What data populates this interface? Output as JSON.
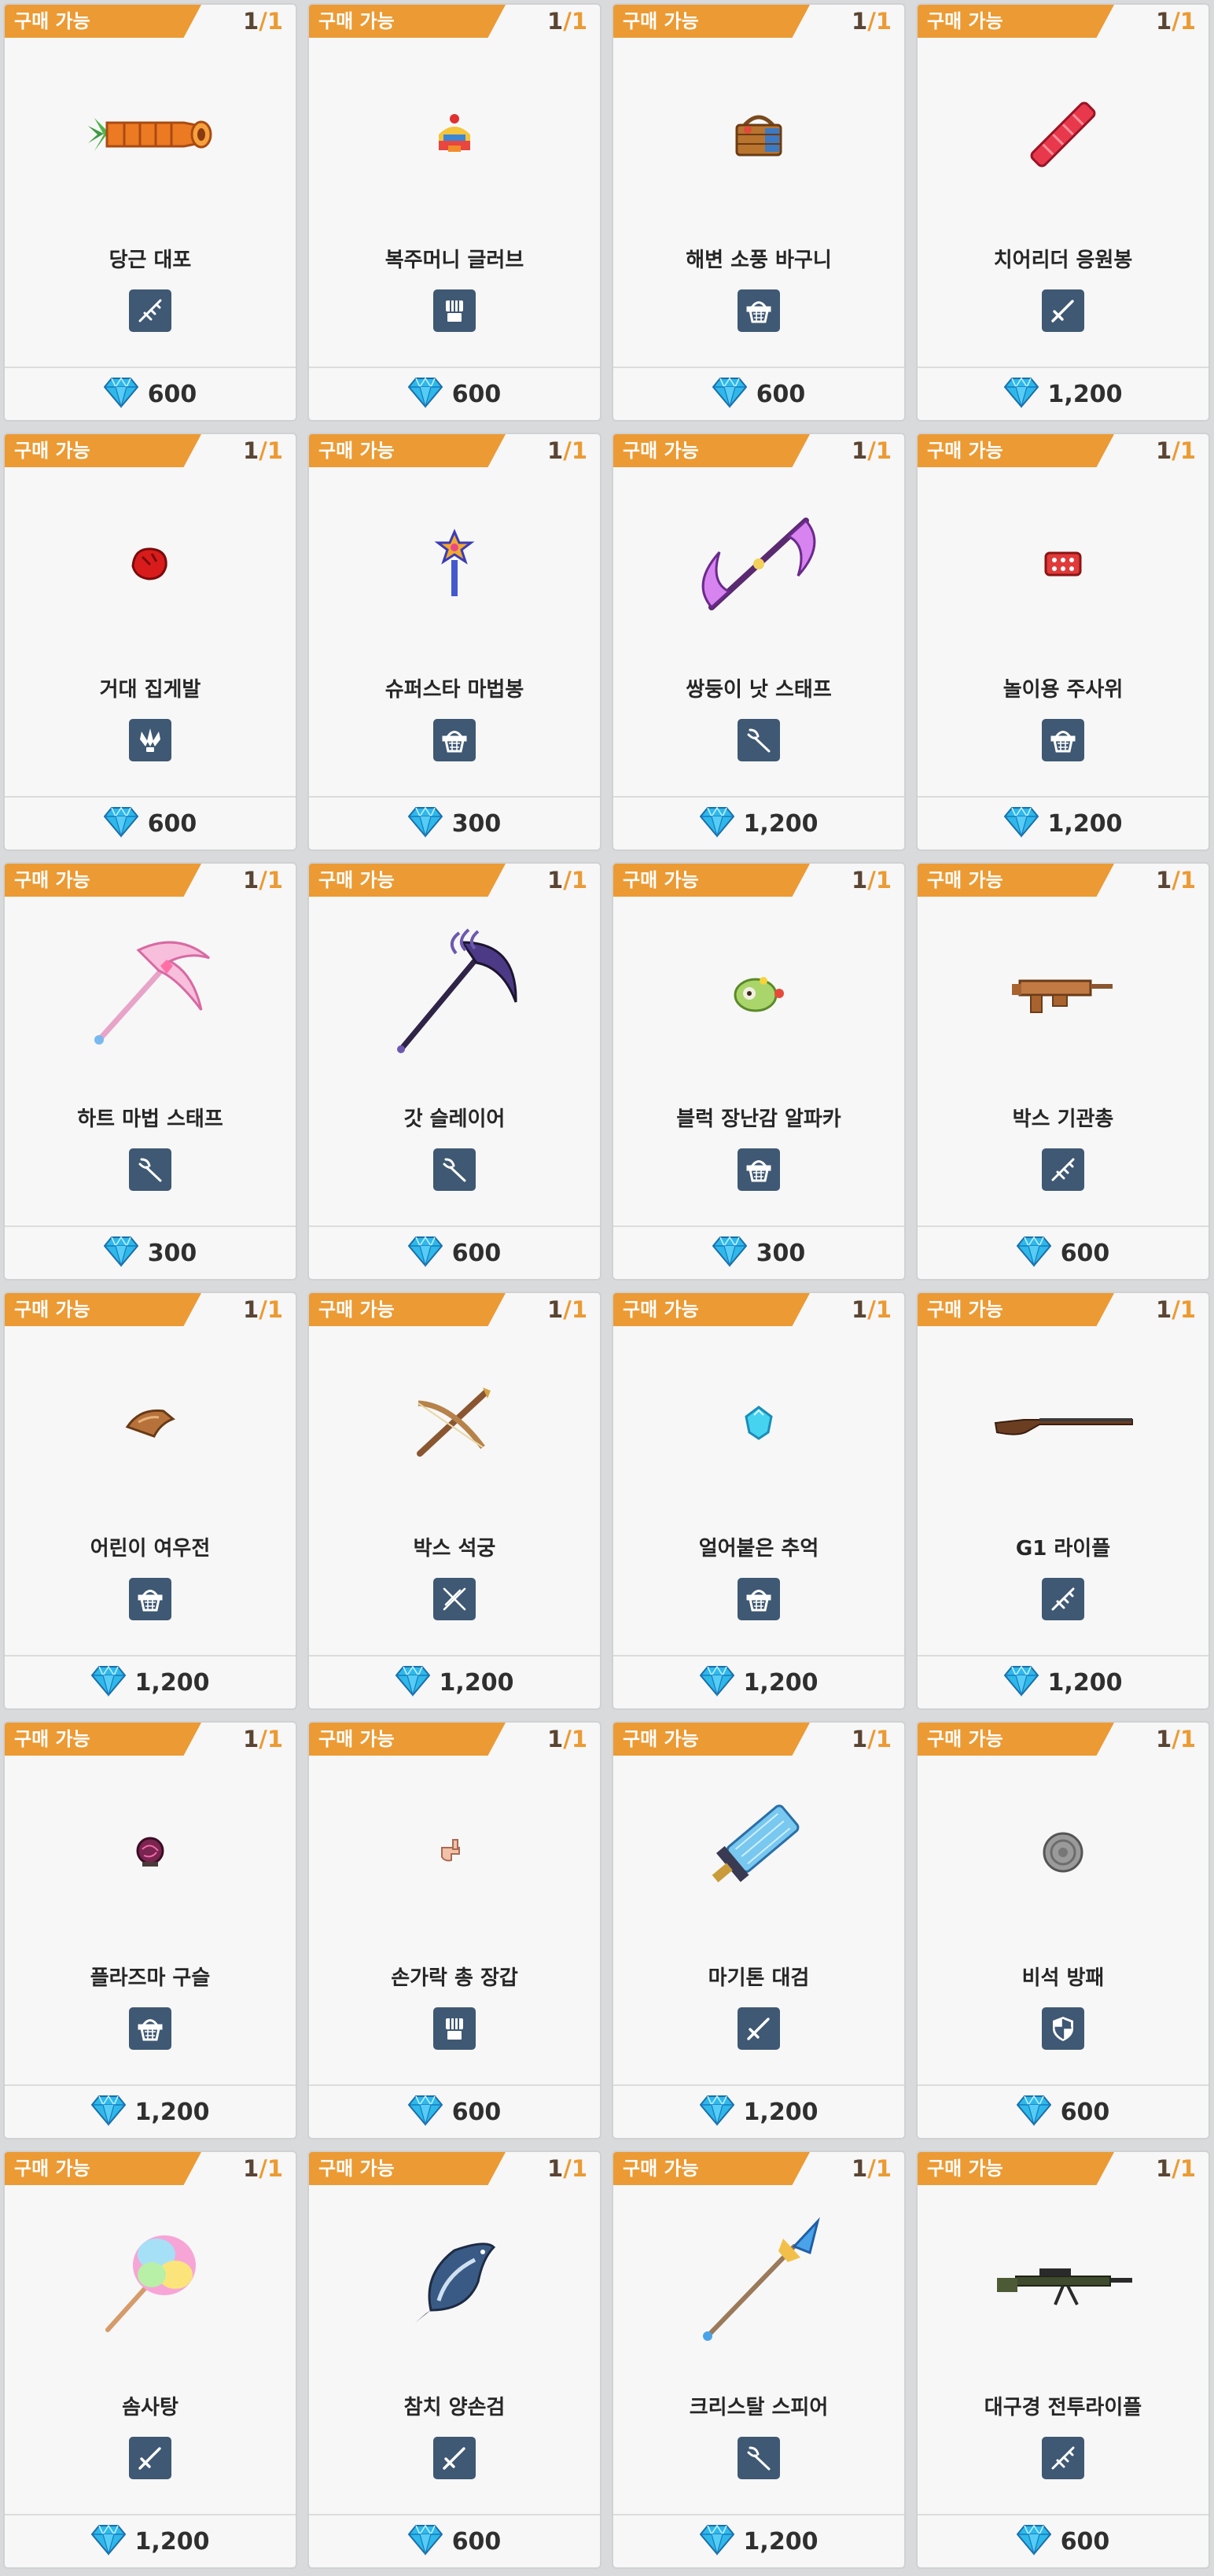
{
  "labels": {
    "available": "구매 가능"
  },
  "colors": {
    "accent": "#ec9a33",
    "badge": "#3f5873",
    "gem": "#2fb8ea"
  },
  "items": [
    {
      "name": "당근 대포",
      "count": "1",
      "max": "1",
      "type": "gun-icon",
      "art": "carrot-cannon",
      "price": "600"
    },
    {
      "name": "복주머니 글러브",
      "count": "1",
      "max": "1",
      "type": "fist-icon",
      "art": "lucky-pouch-glove",
      "price": "600"
    },
    {
      "name": "해변 소풍 바구니",
      "count": "1",
      "max": "1",
      "type": "basket-icon",
      "art": "picnic-basket",
      "price": "600"
    },
    {
      "name": "치어리더 응원봉",
      "count": "1",
      "max": "1",
      "type": "sword-icon",
      "art": "cheer-stick",
      "price": "1,200"
    },
    {
      "name": "거대 집게발",
      "count": "1",
      "max": "1",
      "type": "claw-icon",
      "art": "giant-claw",
      "price": "600"
    },
    {
      "name": "슈퍼스타 마법봉",
      "count": "1",
      "max": "1",
      "type": "basket-icon",
      "art": "superstar-wand",
      "price": "300"
    },
    {
      "name": "쌍둥이 낫 스태프",
      "count": "1",
      "max": "1",
      "type": "staff-icon",
      "art": "twin-scythe-staff",
      "price": "1,200"
    },
    {
      "name": "놀이용 주사위",
      "count": "1",
      "max": "1",
      "type": "basket-icon",
      "art": "play-dice",
      "price": "1,200"
    },
    {
      "name": "하트 마법 스태프",
      "count": "1",
      "max": "1",
      "type": "staff-icon",
      "art": "heart-magic-staff",
      "price": "300"
    },
    {
      "name": "갓 슬레이어",
      "count": "1",
      "max": "1",
      "type": "staff-icon",
      "art": "god-slayer-scythe",
      "price": "600"
    },
    {
      "name": "블럭 장난감 알파카",
      "count": "1",
      "max": "1",
      "type": "basket-icon",
      "art": "block-alpaca",
      "price": "300"
    },
    {
      "name": "박스 기관총",
      "count": "1",
      "max": "1",
      "type": "gun-icon",
      "art": "box-machinegun",
      "price": "600"
    },
    {
      "name": "어린이 여우전",
      "count": "1",
      "max": "1",
      "type": "basket-icon",
      "art": "child-fox-horn",
      "price": "1,200"
    },
    {
      "name": "박스 석궁",
      "count": "1",
      "max": "1",
      "type": "bow-icon",
      "art": "box-crossbow",
      "price": "1,200"
    },
    {
      "name": "얼어붙은 추억",
      "count": "1",
      "max": "1",
      "type": "basket-icon",
      "art": "frozen-memory",
      "price": "1,200"
    },
    {
      "name": "G1 라이플",
      "count": "1",
      "max": "1",
      "type": "gun-icon",
      "art": "g1-rifle",
      "price": "1,200"
    },
    {
      "name": "플라즈마 구슬",
      "count": "1",
      "max": "1",
      "type": "basket-icon",
      "art": "plasma-orb",
      "price": "1,200"
    },
    {
      "name": "손가락 총 장갑",
      "count": "1",
      "max": "1",
      "type": "fist-icon",
      "art": "finger-gun-glove",
      "price": "600"
    },
    {
      "name": "마기톤 대검",
      "count": "1",
      "max": "1",
      "type": "sword-icon",
      "art": "magiton-greatsword",
      "price": "1,200"
    },
    {
      "name": "비석 방패",
      "count": "1",
      "max": "1",
      "type": "shield-icon",
      "art": "tombstone-shield",
      "price": "600"
    },
    {
      "name": "솜사탕",
      "count": "1",
      "max": "1",
      "type": "sword-icon",
      "art": "cotton-candy",
      "price": "1,200"
    },
    {
      "name": "참치 양손검",
      "count": "1",
      "max": "1",
      "type": "sword-icon",
      "art": "tuna-sword",
      "price": "600"
    },
    {
      "name": "크리스탈 스피어",
      "count": "1",
      "max": "1",
      "type": "staff-icon",
      "art": "crystal-spear",
      "price": "1,200"
    },
    {
      "name": "대구경 전투라이플",
      "count": "1",
      "max": "1",
      "type": "gun-icon",
      "art": "heavy-battle-rifle",
      "price": "600"
    }
  ]
}
